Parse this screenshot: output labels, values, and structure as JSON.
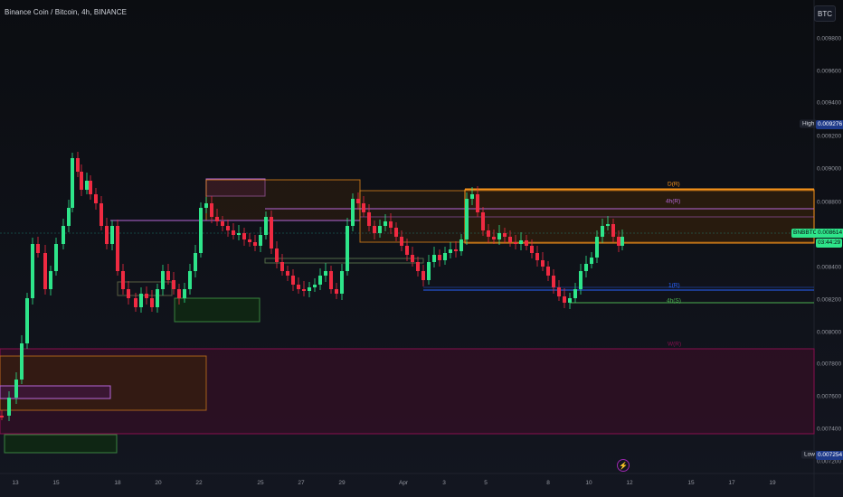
{
  "header": {
    "title": "Binance Coin / Bitcoin, 4h, BINANCE",
    "currency_button": "BTC"
  },
  "price_axis": {
    "ticks": [
      "0.009800",
      "0.009600",
      "0.009400",
      "0.009200",
      "0.009000",
      "0.008800",
      "0.008400",
      "0.008200",
      "0.008000",
      "0.007800",
      "0.007600",
      "0.007400",
      "0.007200"
    ],
    "high_label": "High",
    "high_value": "0.009276",
    "low_label": "Low",
    "low_value": "0.007254",
    "symbol_label": "BNBBTC",
    "last_price": "0.008614",
    "countdown": "03:44:29"
  },
  "time_axis": {
    "ticks": [
      "13",
      "15",
      "18",
      "20",
      "22",
      "25",
      "27",
      "29",
      "Apr",
      "3",
      "5",
      "8",
      "10",
      "12",
      "15",
      "17",
      "19"
    ]
  },
  "levels": {
    "d": "D(R)",
    "four_h": "4h(R)",
    "one_h": "1(R)",
    "support": "4h(S)",
    "weekly": "W(R)"
  },
  "colors": {
    "up": "#26a69a",
    "up_bright": "#2ee58a",
    "down": "#ef2a41",
    "orange": "#f7931a",
    "purple": "#b667d8",
    "blue": "#2962ff",
    "green": "#4caf50",
    "maroon": "#880e4f",
    "last_price_bg": "#2ee58a"
  },
  "icons": {
    "replay": "lightning-icon"
  }
}
